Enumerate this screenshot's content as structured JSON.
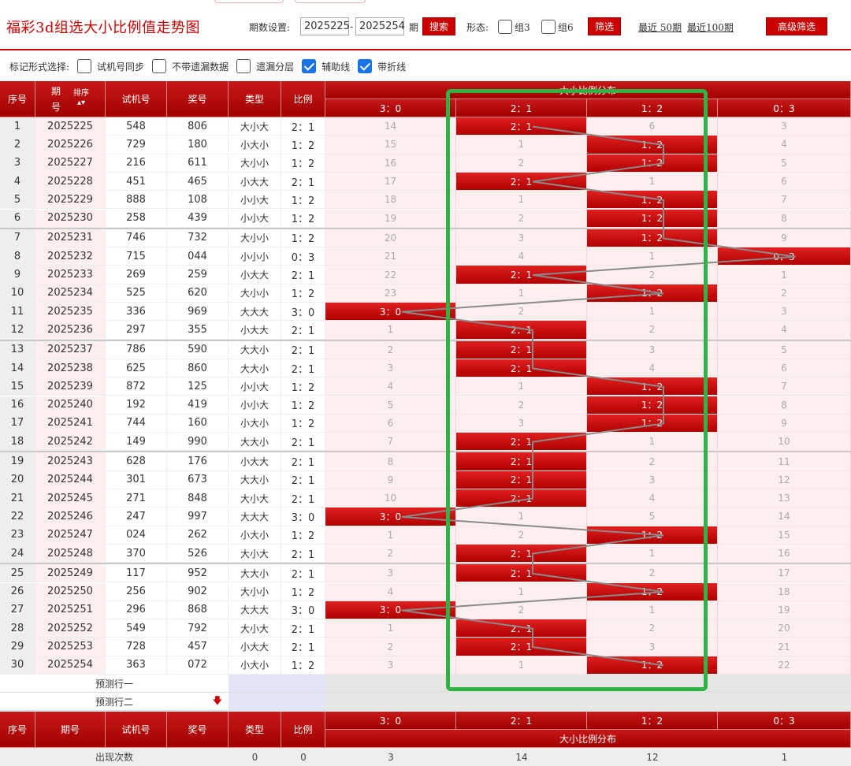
{
  "header": {
    "title": "福彩3d组选大小比例值走势图",
    "period_label": "期数设置:",
    "period_from": "2025225",
    "period_to": "2025254",
    "period_suffix": "期",
    "search_btn": "搜索",
    "form_label": "形态:",
    "group3_label": "组3",
    "group6_label": "组6",
    "filter_btn": "筛选",
    "recent50": "最近 50期",
    "recent100": "最近100期",
    "advanced_btn": "高级筛选"
  },
  "options": {
    "label": "标记形式选择:",
    "items": [
      {
        "label": "试机号同步",
        "checked": false
      },
      {
        "label": "不带遗漏数据",
        "checked": false
      },
      {
        "label": "遗漏分层",
        "checked": false
      },
      {
        "label": "辅助线",
        "checked": true
      },
      {
        "label": "带折线",
        "checked": true
      }
    ]
  },
  "table": {
    "headers": {
      "seq": "序号",
      "period": "期号",
      "sort": "排序",
      "trial": "试机号",
      "prize": "奖号",
      "type": "类型",
      "ratio": "比例",
      "dist_title": "大小比例分布"
    },
    "dist_cols": [
      "3：0",
      "2：1",
      "1：2",
      "0：3"
    ],
    "rows": [
      {
        "seq": "1",
        "period": "2025225",
        "trial": "548",
        "prize": "806",
        "type": "大小大",
        "ratio": "2：1",
        "hit": 1,
        "miss": [
          "14",
          "",
          "6",
          "3"
        ]
      },
      {
        "seq": "2",
        "period": "2025226",
        "trial": "729",
        "prize": "180",
        "type": "小大小",
        "ratio": "1：2",
        "hit": 2,
        "miss": [
          "15",
          "1",
          "",
          "4"
        ]
      },
      {
        "seq": "3",
        "period": "2025227",
        "trial": "216",
        "prize": "611",
        "type": "大小小",
        "ratio": "1：2",
        "hit": 2,
        "miss": [
          "16",
          "2",
          "",
          "5"
        ]
      },
      {
        "seq": "4",
        "period": "2025228",
        "trial": "451",
        "prize": "465",
        "type": "小大大",
        "ratio": "2：1",
        "hit": 1,
        "miss": [
          "17",
          "",
          "1",
          "6"
        ]
      },
      {
        "seq": "5",
        "period": "2025229",
        "trial": "888",
        "prize": "108",
        "type": "小小大",
        "ratio": "1：2",
        "hit": 2,
        "miss": [
          "18",
          "1",
          "",
          "7"
        ]
      },
      {
        "seq": "6",
        "period": "2025230",
        "trial": "258",
        "prize": "439",
        "type": "小小大",
        "ratio": "1：2",
        "hit": 2,
        "miss": [
          "19",
          "2",
          "",
          "8"
        ]
      },
      {
        "seq": "7",
        "period": "2025231",
        "trial": "746",
        "prize": "732",
        "type": "大小小",
        "ratio": "1：2",
        "hit": 2,
        "miss": [
          "20",
          "3",
          "",
          "9"
        ]
      },
      {
        "seq": "8",
        "period": "2025232",
        "trial": "715",
        "prize": "044",
        "type": "小小小",
        "ratio": "0：3",
        "hit": 3,
        "miss": [
          "21",
          "4",
          "1",
          ""
        ]
      },
      {
        "seq": "9",
        "period": "2025233",
        "trial": "269",
        "prize": "259",
        "type": "小大大",
        "ratio": "2：1",
        "hit": 1,
        "miss": [
          "22",
          "",
          "2",
          "1"
        ]
      },
      {
        "seq": "10",
        "period": "2025234",
        "trial": "525",
        "prize": "620",
        "type": "大小小",
        "ratio": "1：2",
        "hit": 2,
        "miss": [
          "23",
          "1",
          "",
          "2"
        ]
      },
      {
        "seq": "11",
        "period": "2025235",
        "trial": "336",
        "prize": "969",
        "type": "大大大",
        "ratio": "3：0",
        "hit": 0,
        "miss": [
          "",
          "2",
          "1",
          "3"
        ]
      },
      {
        "seq": "12",
        "period": "2025236",
        "trial": "297",
        "prize": "355",
        "type": "小大大",
        "ratio": "2：1",
        "hit": 1,
        "miss": [
          "1",
          "",
          "2",
          "4"
        ]
      },
      {
        "seq": "13",
        "period": "2025237",
        "trial": "786",
        "prize": "590",
        "type": "大大小",
        "ratio": "2：1",
        "hit": 1,
        "miss": [
          "2",
          "",
          "3",
          "5"
        ]
      },
      {
        "seq": "14",
        "period": "2025238",
        "trial": "625",
        "prize": "860",
        "type": "大大小",
        "ratio": "2：1",
        "hit": 1,
        "miss": [
          "3",
          "",
          "4",
          "6"
        ]
      },
      {
        "seq": "15",
        "period": "2025239",
        "trial": "872",
        "prize": "125",
        "type": "小小大",
        "ratio": "1：2",
        "hit": 2,
        "miss": [
          "4",
          "1",
          "",
          "7"
        ]
      },
      {
        "seq": "16",
        "period": "2025240",
        "trial": "192",
        "prize": "419",
        "type": "小小大",
        "ratio": "1：2",
        "hit": 2,
        "miss": [
          "5",
          "2",
          "",
          "8"
        ]
      },
      {
        "seq": "17",
        "period": "2025241",
        "trial": "744",
        "prize": "160",
        "type": "小大小",
        "ratio": "1：2",
        "hit": 2,
        "miss": [
          "6",
          "3",
          "",
          "9"
        ]
      },
      {
        "seq": "18",
        "period": "2025242",
        "trial": "149",
        "prize": "990",
        "type": "大大小",
        "ratio": "2：1",
        "hit": 1,
        "miss": [
          "7",
          "",
          "1",
          "10"
        ]
      },
      {
        "seq": "19",
        "period": "2025243",
        "trial": "628",
        "prize": "176",
        "type": "小大大",
        "ratio": "2：1",
        "hit": 1,
        "miss": [
          "8",
          "",
          "2",
          "11"
        ]
      },
      {
        "seq": "20",
        "period": "2025244",
        "trial": "301",
        "prize": "673",
        "type": "大大小",
        "ratio": "2：1",
        "hit": 1,
        "miss": [
          "9",
          "",
          "3",
          "12"
        ]
      },
      {
        "seq": "21",
        "period": "2025245",
        "trial": "271",
        "prize": "848",
        "type": "大小大",
        "ratio": "2：1",
        "hit": 1,
        "miss": [
          "10",
          "",
          "4",
          "13"
        ]
      },
      {
        "seq": "22",
        "period": "2025246",
        "trial": "247",
        "prize": "997",
        "type": "大大大",
        "ratio": "3：0",
        "hit": 0,
        "miss": [
          "",
          "1",
          "5",
          "14"
        ]
      },
      {
        "seq": "23",
        "period": "2025247",
        "trial": "024",
        "prize": "262",
        "type": "小大小",
        "ratio": "1：2",
        "hit": 2,
        "miss": [
          "1",
          "2",
          "",
          "15"
        ]
      },
      {
        "seq": "24",
        "period": "2025248",
        "trial": "370",
        "prize": "526",
        "type": "大小大",
        "ratio": "2：1",
        "hit": 1,
        "miss": [
          "2",
          "",
          "1",
          "16"
        ]
      },
      {
        "seq": "25",
        "period": "2025249",
        "trial": "117",
        "prize": "952",
        "type": "大大小",
        "ratio": "2：1",
        "hit": 1,
        "miss": [
          "3",
          "",
          "2",
          "17"
        ]
      },
      {
        "seq": "26",
        "period": "2025250",
        "trial": "256",
        "prize": "902",
        "type": "大小小",
        "ratio": "1：2",
        "hit": 2,
        "miss": [
          "4",
          "1",
          "",
          "18"
        ]
      },
      {
        "seq": "27",
        "period": "2025251",
        "trial": "296",
        "prize": "868",
        "type": "大大大",
        "ratio": "3：0",
        "hit": 0,
        "miss": [
          "",
          "2",
          "1",
          "19"
        ]
      },
      {
        "seq": "28",
        "period": "2025252",
        "trial": "549",
        "prize": "792",
        "type": "大小大",
        "ratio": "2：1",
        "hit": 1,
        "miss": [
          "1",
          "",
          "2",
          "20"
        ]
      },
      {
        "seq": "29",
        "period": "2025253",
        "trial": "728",
        "prize": "457",
        "type": "小大大",
        "ratio": "2：1",
        "hit": 1,
        "miss": [
          "2",
          "",
          "3",
          "21"
        ]
      },
      {
        "seq": "30",
        "period": "2025254",
        "trial": "363",
        "prize": "072",
        "type": "小大小",
        "ratio": "1：2",
        "hit": 2,
        "miss": [
          "3",
          "1",
          "",
          "22"
        ]
      }
    ],
    "predict1": "预测行一",
    "predict2": "预测行二",
    "footer_counts_label": "出现次数",
    "footer_type_count": "0",
    "footer_ratio_count": "0",
    "footer_dist_counts": [
      "3",
      "14",
      "12",
      "1"
    ]
  },
  "colors": {
    "brand_red": "#cc0000",
    "highlight_green": "#2fb344"
  }
}
